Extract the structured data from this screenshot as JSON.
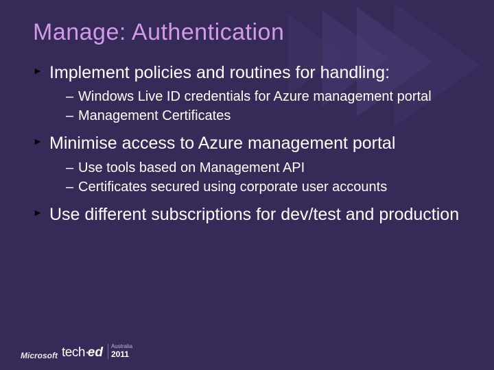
{
  "title": "Manage: Authentication",
  "bullets": [
    {
      "text": "Implement policies and routines for handling:",
      "sub": [
        "Windows Live ID credentials for Azure management portal",
        "Management Certificates"
      ]
    },
    {
      "text": "Minimise access to Azure management portal",
      "sub": [
        "Use tools based on Management API",
        "Certificates secured using corporate user accounts"
      ]
    },
    {
      "text": "Use different subscriptions for dev/test and production",
      "sub": []
    }
  ],
  "footer": {
    "brand": "Microsoft",
    "product_a": "tech·",
    "product_b": "ed",
    "region": "Australia",
    "year": "2011"
  }
}
